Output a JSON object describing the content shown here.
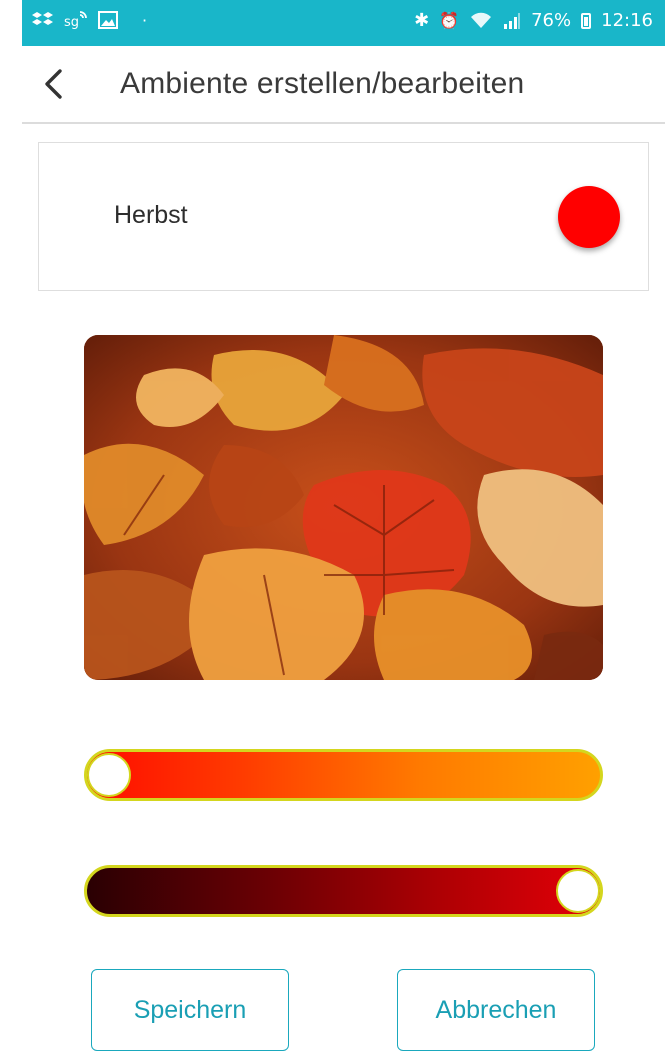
{
  "status_bar": {
    "left_icons": [
      "dropbox-icon",
      "sg-cast-icon",
      "gallery-icon"
    ],
    "dot": "·",
    "bluetooth": "✱",
    "alarm": "⏰",
    "battery_percent": "76%",
    "time": "12:16"
  },
  "header": {
    "title": "Ambiente erstellen/bearbeiten"
  },
  "scene": {
    "name": "Herbst",
    "color": "#ff0000"
  },
  "photo": {
    "description_icon": "autumn-leaves-image"
  },
  "sliders": {
    "hue": {
      "value": 0.0,
      "gradient": [
        "#ff0c00",
        "#ffa000"
      ]
    },
    "brightness": {
      "value": 1.0,
      "gradient": [
        "#2a0003",
        "#e40008"
      ]
    }
  },
  "buttons": {
    "save": "Speichern",
    "cancel": "Abbrechen"
  },
  "colors": {
    "accent": "#19b6c9",
    "button_text": "#1a9fb4",
    "slider_border": "#d4d61e"
  }
}
